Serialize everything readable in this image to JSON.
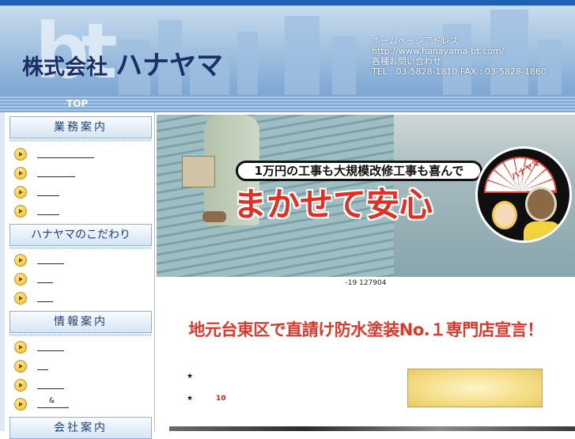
{
  "header": {
    "logo_mark": "bt",
    "company_prefix": "株式会社",
    "company_name": "ハナヤマ",
    "contact": {
      "line1": "ホームページアドレス",
      "line2": "http://www.hanayama-bt.com/",
      "line3": "各種お問い合わせ",
      "line4": "TEL : 03-5828-1810 FAX : 03-5828-1860"
    }
  },
  "nav": {
    "top_label": "TOP"
  },
  "sidebar": {
    "sections": [
      {
        "title": "業務案内",
        "items": [
          {
            "text": ""
          },
          {
            "text": ""
          },
          {
            "text": ""
          },
          {
            "text": ""
          }
        ]
      },
      {
        "title": "ハナヤマのこだわり",
        "items": [
          {
            "text": ""
          },
          {
            "text": ""
          },
          {
            "text": ""
          }
        ]
      },
      {
        "title": "情報案内",
        "items": [
          {
            "text": ""
          },
          {
            "text": ""
          },
          {
            "text": ""
          },
          {
            "text": "&"
          }
        ]
      },
      {
        "title": "会社案内"
      }
    ]
  },
  "hero": {
    "bubble_text": "1万円の工事も大規模改修工事も喜んで",
    "slogan": "まかせて安心",
    "umbrella_text": "ハナヤマ"
  },
  "counter_caption": "-19  127904",
  "headline": "地元台東区で直請け防水塗装No.１専門店宣言！",
  "bullets": {
    "star1": "★",
    "star2": "★",
    "number": "10"
  }
}
